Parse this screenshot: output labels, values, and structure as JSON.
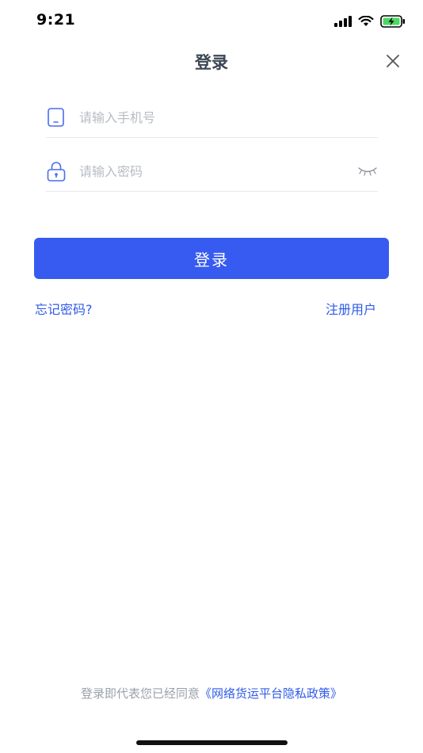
{
  "status_bar": {
    "time": "9:21"
  },
  "header": {
    "title": "登录",
    "close_icon": "close-icon"
  },
  "form": {
    "phone": {
      "icon": "phone-icon",
      "placeholder": "请输入手机号",
      "value": ""
    },
    "password": {
      "icon": "lock-icon",
      "placeholder": "请输入密码",
      "value": "",
      "toggle_icon": "eye-closed-icon"
    },
    "submit_label": "登录"
  },
  "links": {
    "forgot": "忘记密码?",
    "register": "注册用户"
  },
  "agreement": {
    "prefix": "登录即代表您已经同意",
    "policy": "《网络货运平台隐私政策》"
  },
  "colors": {
    "primary": "#375bf1",
    "link": "#2f5be8",
    "placeholder": "#b8bcc4",
    "title": "#3c4653"
  }
}
